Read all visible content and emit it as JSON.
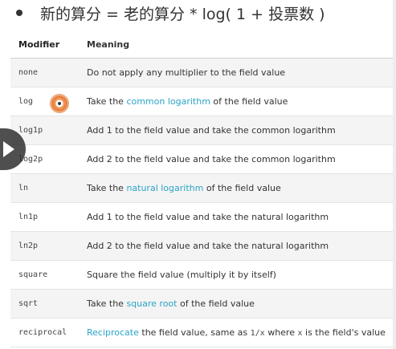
{
  "formula": "新的算分 = 老的算分 * log( 1 + 投票数 )",
  "table": {
    "headers": {
      "modifier": "Modifier",
      "meaning": "Meaning"
    },
    "rows": [
      {
        "modifier": "none",
        "meaning": [
          {
            "t": "Do not apply any multiplier to the field value"
          }
        ]
      },
      {
        "modifier": "log",
        "meaning": [
          {
            "t": "Take the "
          },
          {
            "t": "common logarithm",
            "link": true
          },
          {
            "t": " of the field value"
          }
        ]
      },
      {
        "modifier": "log1p",
        "meaning": [
          {
            "t": "Add 1 to the field value and take the common logarithm"
          }
        ]
      },
      {
        "modifier": "log2p",
        "meaning": [
          {
            "t": "Add 2 to the field value and take the common logarithm"
          }
        ]
      },
      {
        "modifier": "ln",
        "meaning": [
          {
            "t": "Take the "
          },
          {
            "t": "natural logarithm",
            "link": true
          },
          {
            "t": " of the field value"
          }
        ]
      },
      {
        "modifier": "ln1p",
        "meaning": [
          {
            "t": "Add 1 to the field value and take the natural logarithm"
          }
        ]
      },
      {
        "modifier": "ln2p",
        "meaning": [
          {
            "t": "Add 2 to the field value and take the natural logarithm"
          }
        ]
      },
      {
        "modifier": "square",
        "meaning": [
          {
            "t": "Square the field value (multiply it by itself)"
          }
        ]
      },
      {
        "modifier": "sqrt",
        "meaning": [
          {
            "t": "Take the "
          },
          {
            "t": "square root",
            "link": true
          },
          {
            "t": " of the field value"
          }
        ]
      },
      {
        "modifier": "reciprocal",
        "meaning": [
          {
            "t": "Reciprocate",
            "link": true
          },
          {
            "t": " the field value, same as "
          },
          {
            "t": "1/x",
            "code": true
          },
          {
            "t": " where "
          },
          {
            "t": "x",
            "code": true
          },
          {
            "t": " is the field's value"
          }
        ]
      }
    ]
  },
  "colors": {
    "link": "#2aa4c8",
    "row_alt": "#f4f4f4"
  },
  "icons": {
    "play": "play-icon",
    "cursor": "cursor-highlight-icon"
  }
}
